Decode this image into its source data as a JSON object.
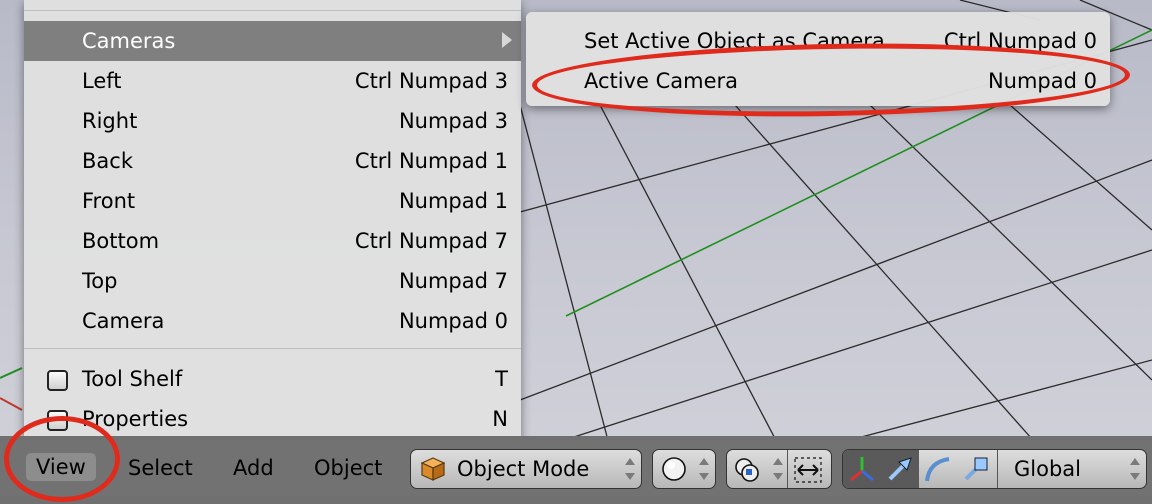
{
  "view_menu": {
    "items": [
      {
        "label": "Cameras",
        "shortcut": ""
      },
      {
        "label": "Left",
        "shortcut": "Ctrl Numpad 3"
      },
      {
        "label": "Right",
        "shortcut": "Numpad 3"
      },
      {
        "label": "Back",
        "shortcut": "Ctrl Numpad 1"
      },
      {
        "label": "Front",
        "shortcut": "Numpad 1"
      },
      {
        "label": "Bottom",
        "shortcut": "Ctrl Numpad 7"
      },
      {
        "label": "Top",
        "shortcut": "Numpad 7"
      },
      {
        "label": "Camera",
        "shortcut": "Numpad 0"
      }
    ],
    "toggles": [
      {
        "label": "Tool Shelf",
        "shortcut": "T"
      },
      {
        "label": "Properties",
        "shortcut": "N"
      }
    ]
  },
  "cameras_submenu": {
    "items": [
      {
        "label": "Set Active Object as Camera",
        "shortcut": "Ctrl Numpad 0"
      },
      {
        "label": "Active Camera",
        "shortcut": "Numpad 0"
      }
    ]
  },
  "header": {
    "menus": [
      "View",
      "Select",
      "Add",
      "Object"
    ],
    "mode": "Object Mode",
    "orientation": "Global"
  },
  "colors": {
    "highlight": "#7f7f7f",
    "menu_bg": "#e0e0e0",
    "header_bg": "#727272",
    "annotation": "#e02a1c",
    "grid_axis": "#1f8f1f"
  },
  "icons": {
    "cameras_arrow": "chevron-right-icon",
    "mode": "cube-icon",
    "shading": "sphere-icon",
    "pivot": "pivot-icon",
    "snap": "snap-icon",
    "manipulator": "axes-icon",
    "translate": "translate-arrow-icon",
    "rotate": "rotate-icon",
    "scale": "scale-icon"
  }
}
